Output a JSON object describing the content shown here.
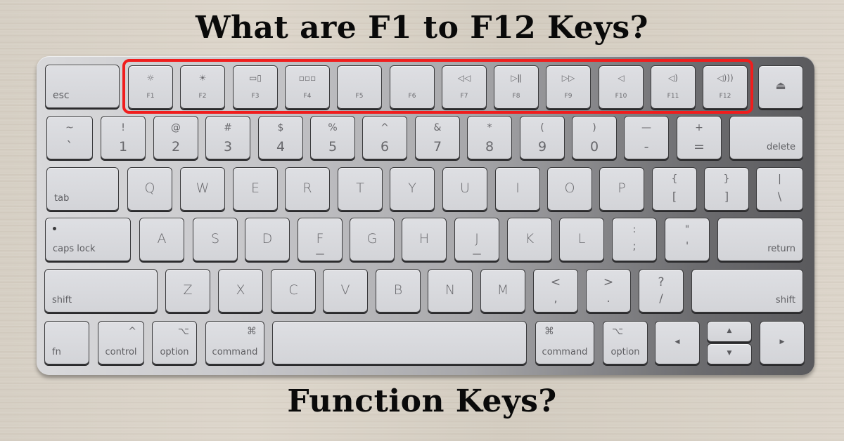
{
  "headline_top": "What are F1 to F12 Keys?",
  "headline_bottom": "Function Keys?",
  "highlight_color": "#f01d1d",
  "function_row": {
    "esc": "esc",
    "keys": [
      {
        "label": "F1",
        "icon": "brightness-down-icon",
        "glyph": "☼"
      },
      {
        "label": "F2",
        "icon": "brightness-up-icon",
        "glyph": "☀"
      },
      {
        "label": "F3",
        "icon": "mission-control-icon",
        "glyph": "▭▯"
      },
      {
        "label": "F4",
        "icon": "launchpad-icon",
        "glyph": "▫▫▫"
      },
      {
        "label": "F5",
        "icon": "",
        "glyph": ""
      },
      {
        "label": "F6",
        "icon": "",
        "glyph": ""
      },
      {
        "label": "F7",
        "icon": "rewind-icon",
        "glyph": "◁◁"
      },
      {
        "label": "F8",
        "icon": "play-pause-icon",
        "glyph": "▷ǁ"
      },
      {
        "label": "F9",
        "icon": "fast-forward-icon",
        "glyph": "▷▷"
      },
      {
        "label": "F10",
        "icon": "mute-icon",
        "glyph": "◁"
      },
      {
        "label": "F11",
        "icon": "volume-down-icon",
        "glyph": "◁)"
      },
      {
        "label": "F12",
        "icon": "volume-up-icon",
        "glyph": "◁)))"
      }
    ],
    "eject_glyph": "⏏"
  },
  "number_row": {
    "keys": [
      {
        "upper": "~",
        "lower": "`"
      },
      {
        "upper": "!",
        "lower": "1"
      },
      {
        "upper": "@",
        "lower": "2"
      },
      {
        "upper": "#",
        "lower": "3"
      },
      {
        "upper": "$",
        "lower": "4"
      },
      {
        "upper": "%",
        "lower": "5"
      },
      {
        "upper": "^",
        "lower": "6"
      },
      {
        "upper": "&",
        "lower": "7"
      },
      {
        "upper": "*",
        "lower": "8"
      },
      {
        "upper": "(",
        "lower": "9"
      },
      {
        "upper": ")",
        "lower": "0"
      },
      {
        "upper": "—",
        "lower": "-"
      },
      {
        "upper": "+",
        "lower": "="
      }
    ],
    "delete": "delete"
  },
  "qwerty_row": {
    "tab": "tab",
    "letters": [
      "Q",
      "W",
      "E",
      "R",
      "T",
      "Y",
      "U",
      "I",
      "O",
      "P"
    ],
    "brackets": [
      {
        "upper": "{",
        "lower": "["
      },
      {
        "upper": "}",
        "lower": "]"
      },
      {
        "upper": "|",
        "lower": "\\"
      }
    ]
  },
  "home_row": {
    "caps_lock": "caps lock",
    "letters": [
      "A",
      "S",
      "D",
      "F",
      "G",
      "H",
      "J",
      "K",
      "L"
    ],
    "punct": [
      {
        "upper": ":",
        "lower": ";"
      },
      {
        "upper": "\"",
        "lower": "'"
      }
    ],
    "return": "return"
  },
  "bottom_letter_row": {
    "shift_left": "shift",
    "letters": [
      "Z",
      "X",
      "C",
      "V",
      "B",
      "N",
      "M"
    ],
    "punct": [
      {
        "upper": "<",
        "lower": ","
      },
      {
        "upper": ">",
        "lower": "."
      },
      {
        "upper": "?",
        "lower": "/"
      }
    ],
    "shift_right": "shift"
  },
  "modifier_row": {
    "fn": "fn",
    "control": "control",
    "control_symbol": "^",
    "option_left": "option",
    "option_symbol": "⌥",
    "command_left": "command",
    "command_symbol": "⌘",
    "command_right": "command",
    "option_right": "option",
    "arrow_left": "◀",
    "arrow_up": "▲",
    "arrow_down": "▼",
    "arrow_right": "▶"
  }
}
